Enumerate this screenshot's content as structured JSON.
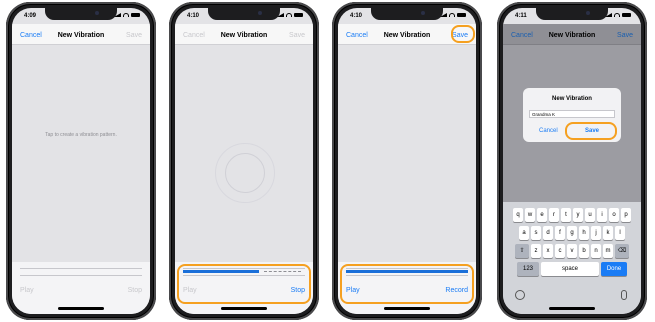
{
  "phones": [
    {
      "time": "4:09",
      "nav": {
        "cancel": "Cancel",
        "title": "New Vibration",
        "save": "Save"
      },
      "hint": "Tap to create a vibration pattern.",
      "bottom": {
        "play": "Play",
        "right": "Stop"
      }
    },
    {
      "time": "4:10",
      "nav": {
        "cancel": "Cancel",
        "title": "New Vibration",
        "save": "Save"
      },
      "bottom": {
        "play": "Play",
        "right": "Stop"
      }
    },
    {
      "time": "4:10",
      "nav": {
        "cancel": "Cancel",
        "title": "New Vibration",
        "save": "Save"
      },
      "bottom": {
        "play": "Play",
        "right": "Record"
      }
    },
    {
      "time": "4:11",
      "nav": {
        "cancel": "Cancel",
        "title": "New Vibration",
        "save": "Save"
      },
      "alert": {
        "title": "New Vibration",
        "field_value": "Grandma K",
        "cancel": "Cancel",
        "save": "Save"
      },
      "keyboard": {
        "row1": [
          "q",
          "w",
          "e",
          "r",
          "t",
          "y",
          "u",
          "i",
          "o",
          "p"
        ],
        "row2": [
          "a",
          "s",
          "d",
          "f",
          "g",
          "h",
          "j",
          "k",
          "l"
        ],
        "row3": [
          "z",
          "x",
          "c",
          "v",
          "b",
          "n",
          "m"
        ],
        "numbers": "123",
        "space": "space",
        "done": "Done"
      }
    }
  ],
  "accent": "#1a7cf5",
  "highlight_color": "#f5a020"
}
